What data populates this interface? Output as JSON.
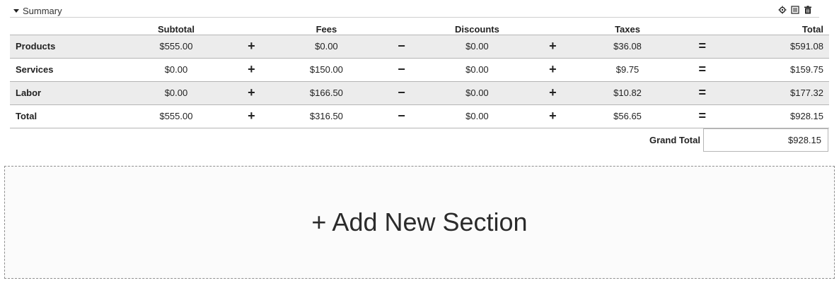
{
  "summary": {
    "title": "Summary",
    "toolbar": {
      "settings_icon": "gear-icon",
      "layout_icon": "list-icon",
      "delete_icon": "trash-icon"
    },
    "columns": [
      "",
      "Subtotal",
      "",
      "Fees",
      "",
      "Discounts",
      "",
      "Taxes",
      "",
      "Total"
    ],
    "rows": [
      {
        "label": "Products",
        "subtotal": "$555.00",
        "fees": "$0.00",
        "discounts": "$0.00",
        "taxes": "$36.08",
        "total": "$591.08"
      },
      {
        "label": "Services",
        "subtotal": "$0.00",
        "fees": "$150.00",
        "discounts": "$0.00",
        "taxes": "$9.75",
        "total": "$159.75"
      },
      {
        "label": "Labor",
        "subtotal": "$0.00",
        "fees": "$166.50",
        "discounts": "$0.00",
        "taxes": "$10.82",
        "total": "$177.32"
      },
      {
        "label": "Total",
        "subtotal": "$555.00",
        "fees": "$316.50",
        "discounts": "$0.00",
        "taxes": "$56.65",
        "total": "$928.15"
      }
    ],
    "operators": {
      "plus": "+",
      "minus": "−",
      "equals": "="
    },
    "grand_total": {
      "label": "Grand Total",
      "value": "$928.15"
    }
  },
  "add_section": {
    "label": "+ Add New Section"
  }
}
